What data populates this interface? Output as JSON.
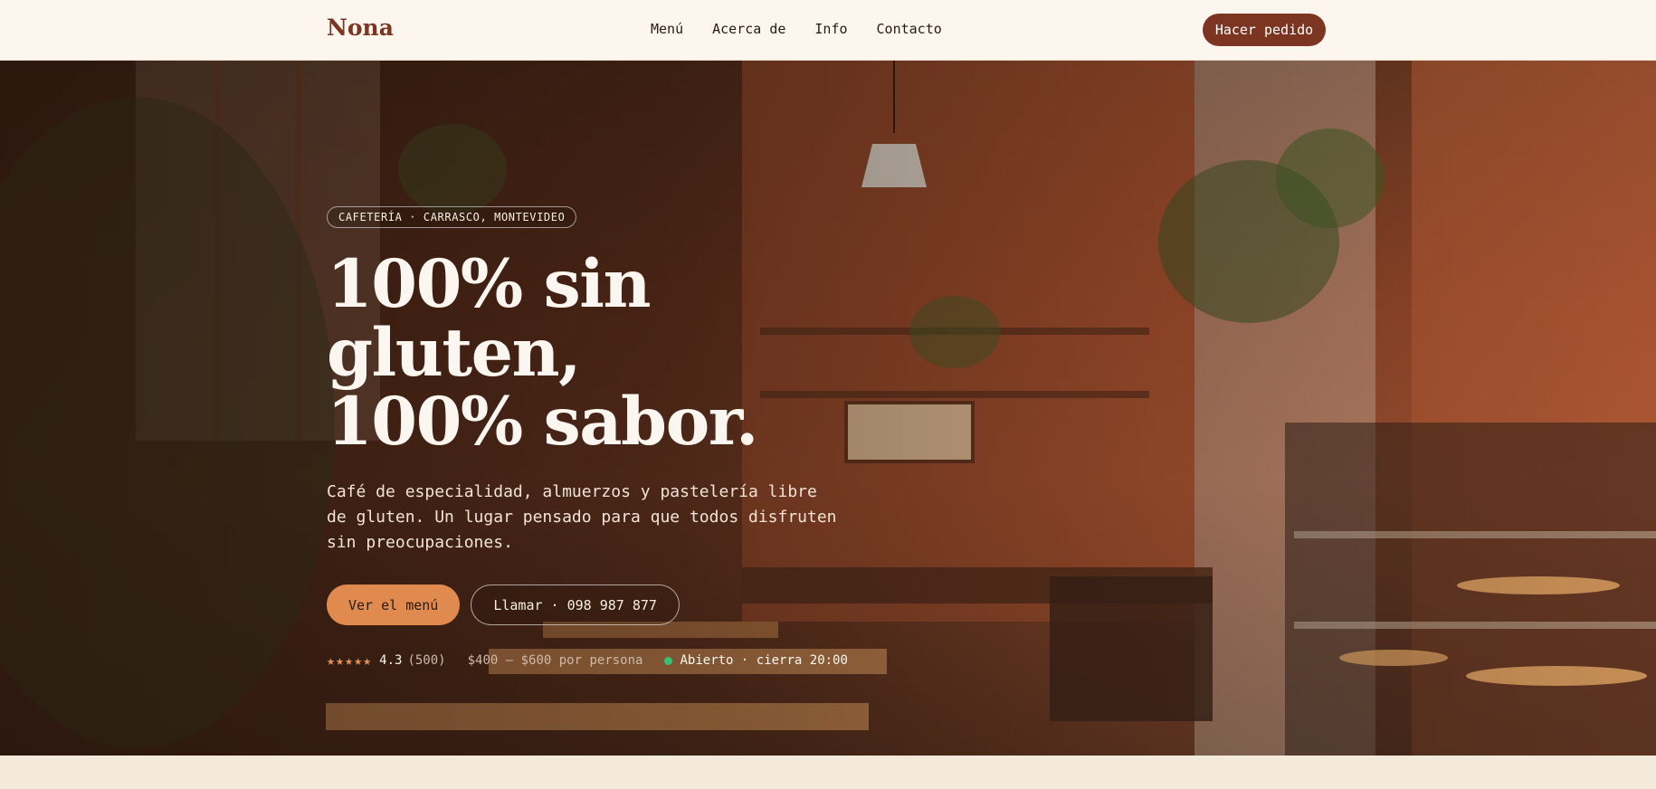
{
  "nav": {
    "logo": "Nona",
    "links": [
      "Menú",
      "Acerca de",
      "Info",
      "Contacto"
    ],
    "order_button": "Hacer pedido"
  },
  "hero": {
    "tag": "CAFETERÍA · CARRASCO, MONTEVIDEO",
    "headline_line1": "100% sin gluten,",
    "headline_line2": "100% sabor.",
    "lead": "Café de especialidad, almuerzos y pastelería libre de gluten. Un lugar pensado para que todos disfruten sin preocupaciones.",
    "primary_cta": "Ver el menú",
    "secondary_cta": "Llamar · 098 987 877",
    "stars": "★★★★★",
    "rating": "4.3",
    "reviews": "(500)",
    "price": "$400 — $600 por persona",
    "status": "Abierto · cierra 20:00"
  },
  "colors": {
    "brand": "#7c3520",
    "accent": "#e08a4f",
    "open_indicator": "#38c172",
    "background": "#fcf6ee"
  }
}
